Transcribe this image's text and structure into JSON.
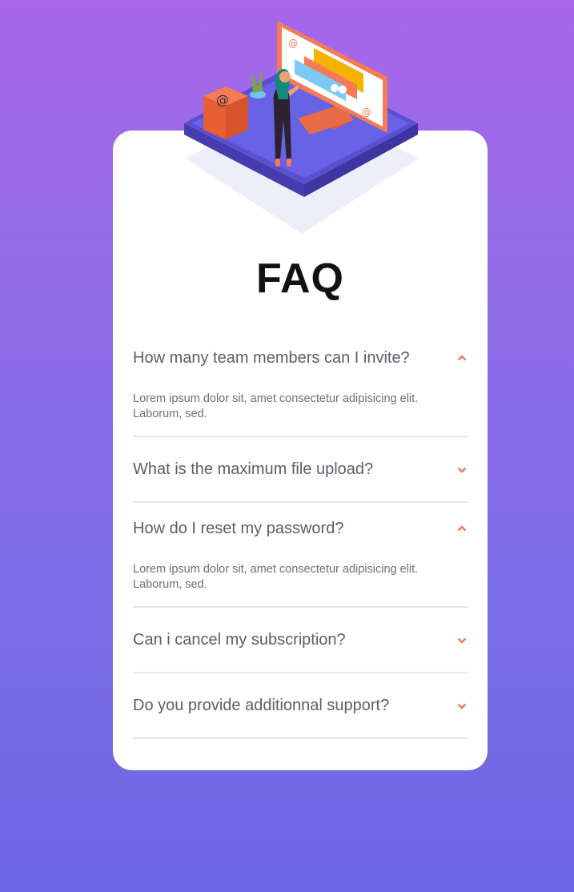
{
  "colors": {
    "accent": "#f47b56",
    "card_bg": "#ffffff",
    "text_muted": "#5d5d6b",
    "divider": "#e6e6e9"
  },
  "illustration": {
    "name": "woman-online-illustration"
  },
  "page": {
    "title": "FAQ"
  },
  "faq": [
    {
      "question": "How many team members can I invite?",
      "answer": "Lorem ipsum dolor sit, amet consectetur adipisicing elit. Laborum, sed.",
      "expanded": true,
      "icon": "chevron-up-icon"
    },
    {
      "question": "What is the maximum file upload?",
      "answer": "",
      "expanded": false,
      "icon": "chevron-down-icon"
    },
    {
      "question": "How do I reset my password?",
      "answer": "Lorem ipsum dolor sit, amet consectetur adipisicing elit. Laborum, sed.",
      "expanded": true,
      "icon": "chevron-up-icon"
    },
    {
      "question": "Can i cancel my subscription?",
      "answer": "",
      "expanded": false,
      "icon": "chevron-down-icon"
    },
    {
      "question": "Do you provide additionnal support?",
      "answer": "",
      "expanded": false,
      "icon": "chevron-down-icon"
    }
  ]
}
